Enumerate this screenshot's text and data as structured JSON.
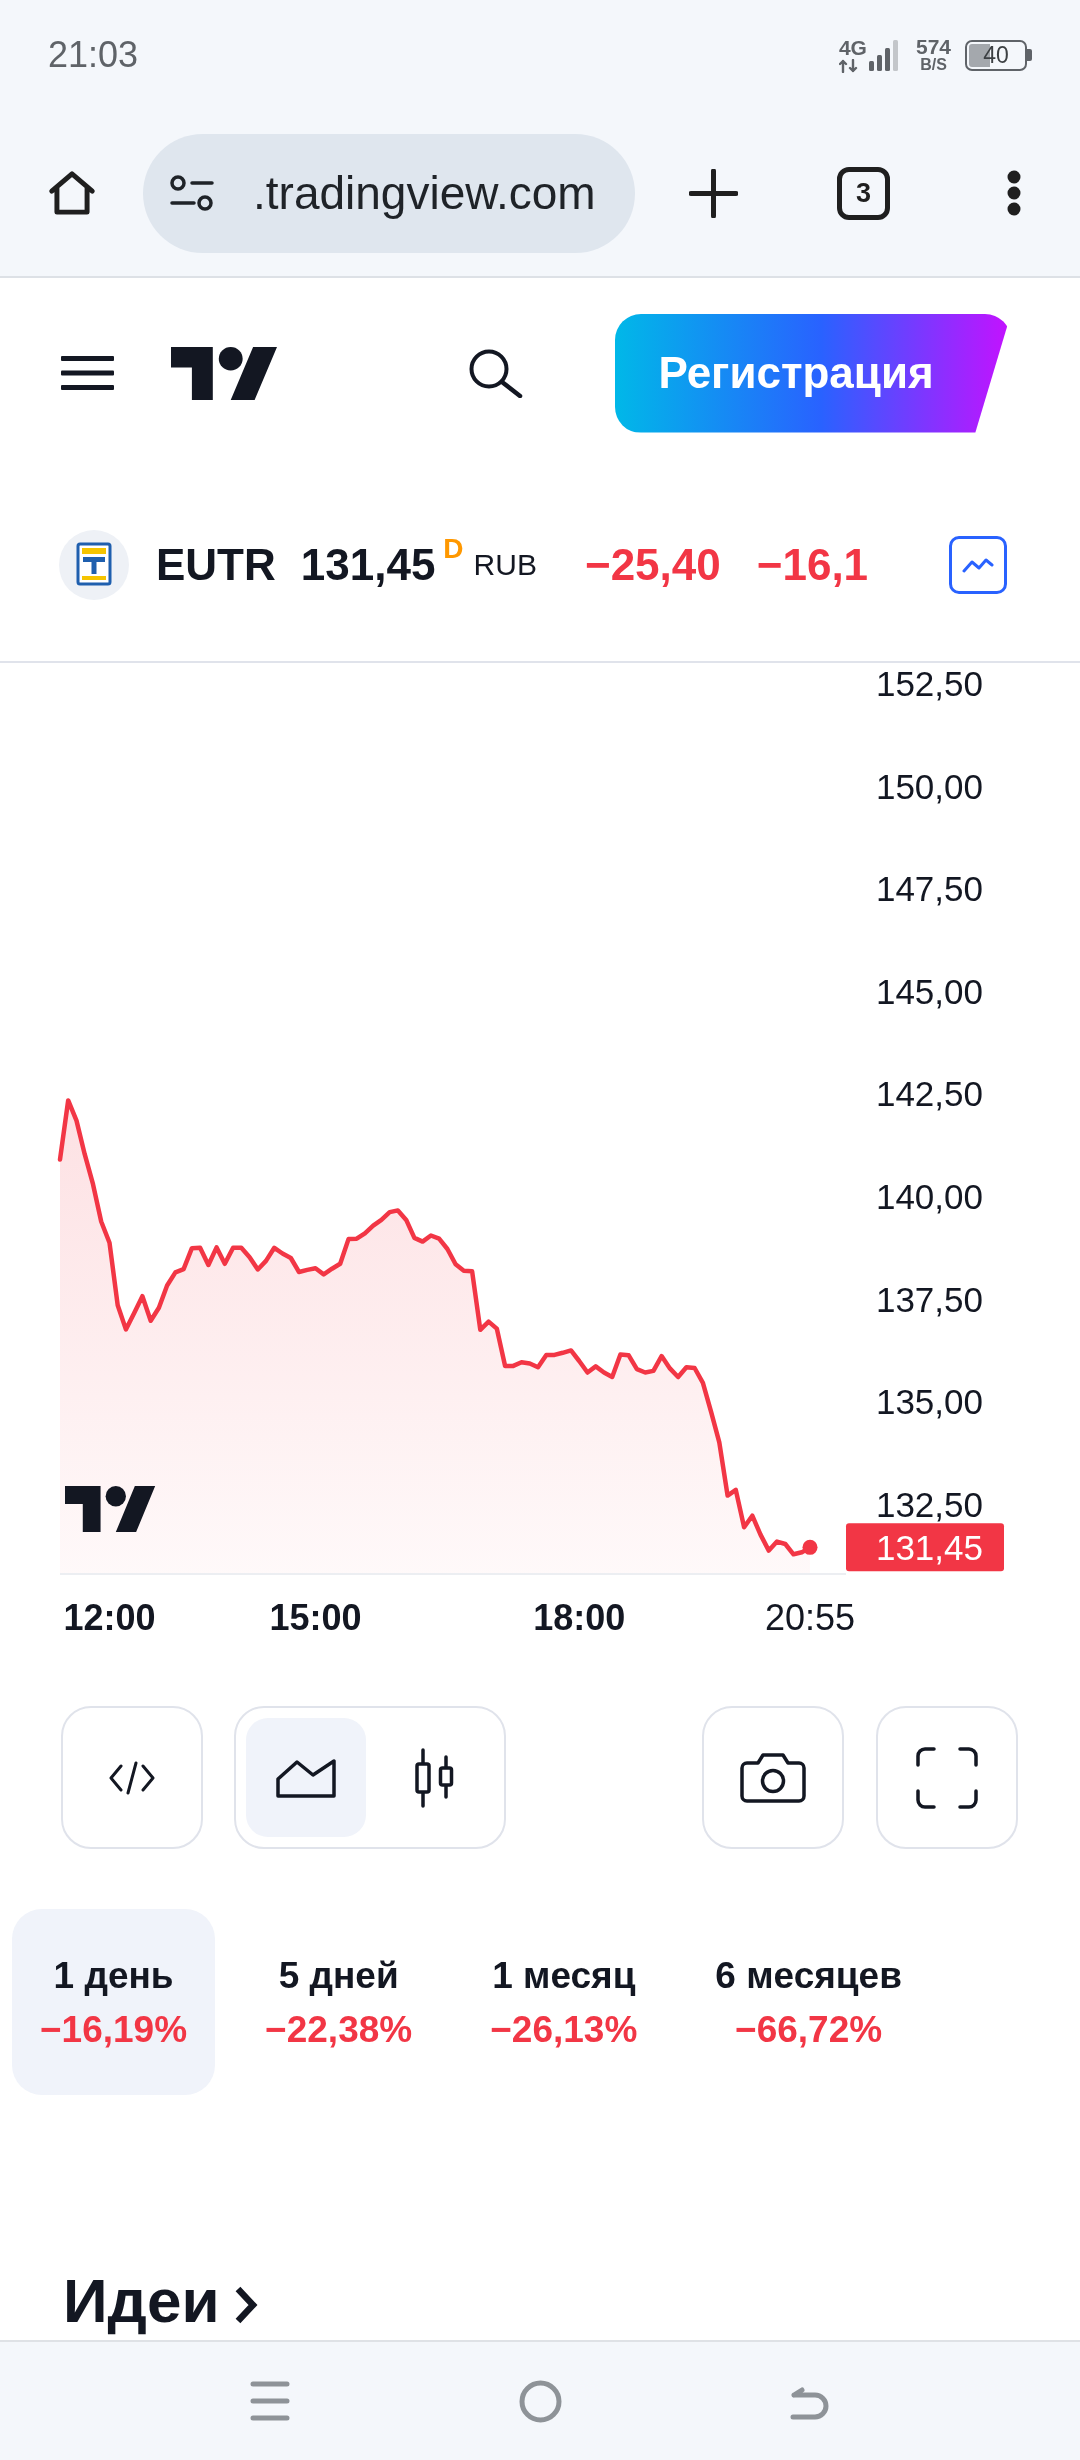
{
  "status_bar": {
    "time": "21:03",
    "network": "4G",
    "speed": "574",
    "speed_unit": "B/S",
    "battery": "40"
  },
  "browser": {
    "url": ".tradingview.com",
    "tab_count": "3"
  },
  "header": {
    "register_button": "Регистрация"
  },
  "symbol": {
    "ticker": "EUTR",
    "price": "131,45",
    "price_mark": "D",
    "currency": "RUB",
    "change": "−25,40",
    "change_percent": "−16,1"
  },
  "chart": {
    "chart_data": {
      "type": "area",
      "categories": [
        null,
        null,
        null,
        null,
        null,
        null,
        "12:00",
        null,
        null,
        null,
        null,
        null,
        null,
        null,
        null,
        null,
        null,
        null,
        null,
        null,
        null,
        null,
        null,
        null,
        null,
        null,
        null,
        null,
        null,
        null,
        null,
        "15:00",
        null,
        null,
        null,
        null,
        null,
        null,
        null,
        null,
        null,
        null,
        null,
        null,
        null,
        null,
        null,
        null,
        null,
        null,
        null,
        null,
        null,
        null,
        null,
        null,
        null,
        null,
        null,
        null,
        null,
        null,
        null,
        "18:00",
        null,
        null,
        null,
        null,
        null,
        null,
        null,
        null,
        null,
        null,
        null,
        null,
        null,
        null,
        null,
        null,
        null,
        null,
        null,
        null,
        null,
        null,
        null,
        null,
        null,
        null,
        null,
        "20:55"
      ],
      "values": [
        140.9,
        142.34,
        141.85,
        141.03,
        140.3,
        139.39,
        138.87,
        137.35,
        136.76,
        137.16,
        137.57,
        136.97,
        137.29,
        137.83,
        138.15,
        138.23,
        138.74,
        138.75,
        138.33,
        138.76,
        138.36,
        138.75,
        138.75,
        138.52,
        138.22,
        138.43,
        138.75,
        138.61,
        138.5,
        138.16,
        138.21,
        138.25,
        138.1,
        138.24,
        138.36,
        138.96,
        138.97,
        139.1,
        139.29,
        139.43,
        139.62,
        139.66,
        139.43,
        138.99,
        138.9,
        139.05,
        138.97,
        138.72,
        138.35,
        138.19,
        138.18,
        136.75,
        136.95,
        136.78,
        135.87,
        135.87,
        135.96,
        135.93,
        135.84,
        136.14,
        136.14,
        136.19,
        136.25,
        135.99,
        135.71,
        135.86,
        135.71,
        135.6,
        136.15,
        136.13,
        135.79,
        135.71,
        135.75,
        136.11,
        135.81,
        135.6,
        135.84,
        135.82,
        135.46,
        134.75,
        134.01,
        132.71,
        132.85,
        131.94,
        132.22,
        131.76,
        131.37,
        131.59,
        131.53,
        131.28,
        131.33,
        131.45
      ],
      "yticks": [
        {
          "value": 132.5,
          "label": "132,50"
        },
        {
          "value": 135,
          "label": "135,00"
        },
        {
          "value": 137.5,
          "label": "137,50"
        },
        {
          "value": 140,
          "label": "140,00"
        },
        {
          "value": 142.5,
          "label": "142,50"
        },
        {
          "value": 145,
          "label": "145,00"
        },
        {
          "value": 147.5,
          "label": "147,50"
        },
        {
          "value": 150,
          "label": "150,00"
        },
        {
          "value": 152.5,
          "label": "152,50"
        }
      ],
      "ylim": [
        130.8,
        153
      ]
    },
    "last_price_label": "131,45"
  },
  "chart_tools": {
    "chart_types": [
      {
        "kind": "area",
        "selected": true
      },
      {
        "kind": "candles",
        "selected": false
      }
    ]
  },
  "periods": [
    {
      "label": "1 день",
      "change": "−16,19%",
      "selected": true
    },
    {
      "label": "5 дней",
      "change": "−22,38%",
      "selected": false
    },
    {
      "label": "1 месяц",
      "change": "−26,13%",
      "selected": false
    },
    {
      "label": "6 месяцев",
      "change": "−66,72%",
      "selected": false
    }
  ],
  "ideas": {
    "title": "Идеи"
  }
}
